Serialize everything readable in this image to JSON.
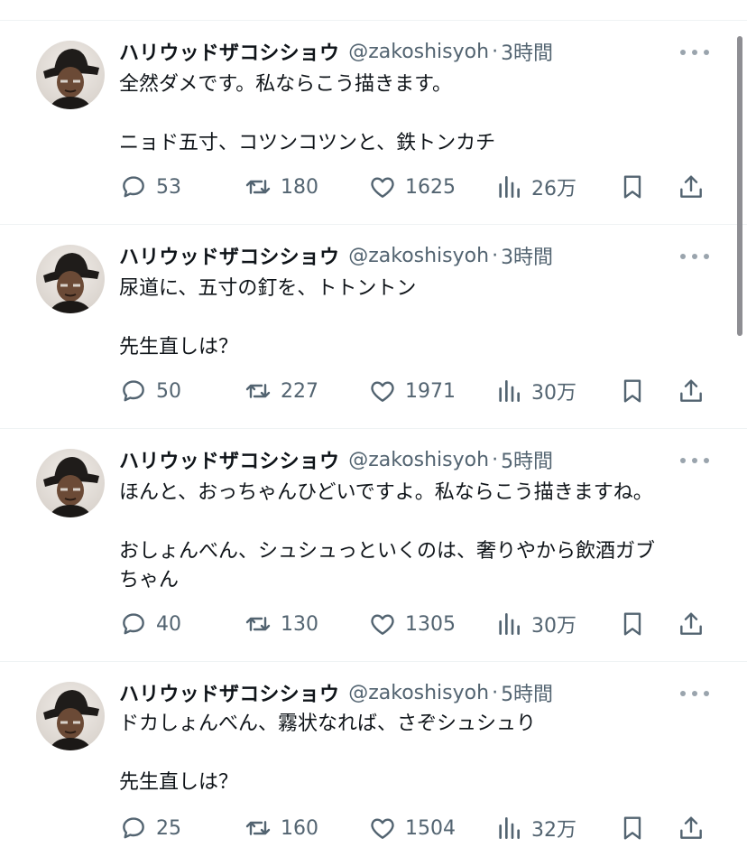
{
  "tweets": [
    {
      "name": "ハリウッドザコシショウ",
      "handle": "@zakoshisyoh",
      "separator": "·",
      "time": "3時間",
      "lines": [
        "全然ダメです。私ならこう描きます。",
        "",
        "ニョド五寸、コツンコツンと、鉄トンカチ"
      ],
      "replies": "53",
      "retweets": "180",
      "likes": "1625",
      "views": "26万"
    },
    {
      "name": "ハリウッドザコシショウ",
      "handle": "@zakoshisyoh",
      "separator": "·",
      "time": "3時間",
      "lines": [
        "尿道に、五寸の釘を、トトントン",
        "",
        "先生直しは？"
      ],
      "replies": "50",
      "retweets": "227",
      "likes": "1971",
      "views": "30万"
    },
    {
      "name": "ハリウッドザコシショウ",
      "handle": "@zakoshisyoh",
      "separator": "·",
      "time": "5時間",
      "lines": [
        "ほんと、おっちゃんひどいですよ。私ならこう描きますね。",
        "",
        "おしょんべん、シュシュっといくのは、奢りやから飲酒ガブ",
        "ちゃん"
      ],
      "replies": "40",
      "retweets": "130",
      "likes": "1305",
      "views": "30万"
    },
    {
      "name": "ハリウッドザコシショウ",
      "handle": "@zakoshisyoh",
      "separator": "·",
      "time": "5時間",
      "lines": [
        "ドカしょんべん、霧状なれば、さぞシュシュり",
        "",
        "先生直しは？"
      ],
      "replies": "25",
      "retweets": "160",
      "likes": "1504",
      "views": "32万"
    }
  ],
  "icons": {
    "reply": "speech-bubble",
    "retweet": "retweet-arrows",
    "like": "heart-outline",
    "views": "bar-chart",
    "bookmark": "bookmark-outline",
    "share": "share-upload",
    "more": "three-dots"
  },
  "colors": {
    "text": "#0f1419",
    "secondary": "#536471",
    "divider": "#eff3f4",
    "scrollbar": "#8e8e93"
  }
}
